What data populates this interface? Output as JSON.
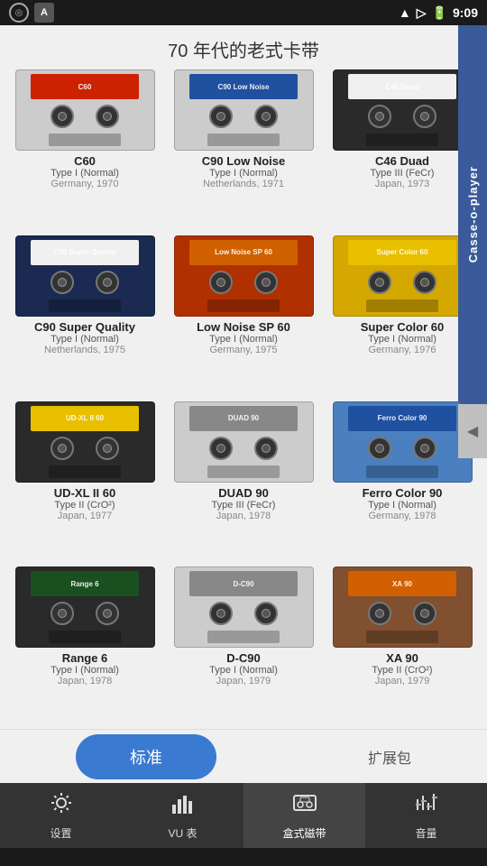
{
  "statusBar": {
    "time": "9:09",
    "icons": [
      "compass",
      "A"
    ]
  },
  "page": {
    "title": "70 年代的老式卡带"
  },
  "rightTab": {
    "label": "Casse-o-player"
  },
  "cassettes": [
    {
      "id": "c60",
      "name": "C60",
      "type": "Type I (Normal)",
      "origin": "Germany, 1970",
      "shell": "light",
      "labelColor": "red"
    },
    {
      "id": "c90ln",
      "name": "C90 Low Noise",
      "type": "Type I (Normal)",
      "origin": "Netherlands, 1971",
      "shell": "light",
      "labelColor": "blue"
    },
    {
      "id": "c46duad",
      "name": "C46 Duad",
      "type": "Type III (FeCr)",
      "origin": "Japan, 1973",
      "shell": "dark",
      "labelColor": "white"
    },
    {
      "id": "c90sq",
      "name": "C90 Super Quality",
      "type": "Type I (Normal)",
      "origin": "Netherlands, 1975",
      "shell": "navy",
      "labelColor": "white"
    },
    {
      "id": "lnsp60",
      "name": "Low Noise SP 60",
      "type": "Type I (Normal)",
      "origin": "Germany, 1975",
      "shell": "red",
      "labelColor": "orange"
    },
    {
      "id": "sc60",
      "name": "Super Color 60",
      "type": "Type I (Normal)",
      "origin": "Germany, 1976",
      "shell": "yellow",
      "labelColor": "yellow"
    },
    {
      "id": "udxl",
      "name": "UD-XL II 60",
      "type": "Type II (CrO²)",
      "origin": "Japan, 1977",
      "shell": "dark",
      "labelColor": "yellow"
    },
    {
      "id": "duad90",
      "name": "DUAD 90",
      "type": "Type III (FeCr)",
      "origin": "Japan, 1978",
      "shell": "light",
      "labelColor": "gray"
    },
    {
      "id": "ferrocolor",
      "name": "Ferro Color 90",
      "type": "Type I (Normal)",
      "origin": "Germany, 1978",
      "shell": "blue",
      "labelColor": "blue"
    },
    {
      "id": "range6",
      "name": "Range 6",
      "type": "Type I (Normal)",
      "origin": "Japan, 1978",
      "shell": "dark",
      "labelColor": "green"
    },
    {
      "id": "dc90",
      "name": "D-C90",
      "type": "Type I (Normal)",
      "origin": "Japan, 1979",
      "shell": "light",
      "labelColor": "gray"
    },
    {
      "id": "xa90",
      "name": "XA 90",
      "type": "Type II (CrO²)",
      "origin": "Japan, 1979",
      "shell": "brown",
      "labelColor": "orange"
    }
  ],
  "bottomButtons": {
    "standard": "标准",
    "expansion": "扩展包"
  },
  "tabs": [
    {
      "id": "settings",
      "label": "设置",
      "icon": "⚙",
      "active": false
    },
    {
      "id": "vu",
      "label": "VU 表",
      "icon": "📊",
      "active": false
    },
    {
      "id": "cassette",
      "label": "盒式磁带",
      "icon": "🎛",
      "active": true
    },
    {
      "id": "volume",
      "label": "音量",
      "icon": "🎚",
      "active": false
    }
  ]
}
